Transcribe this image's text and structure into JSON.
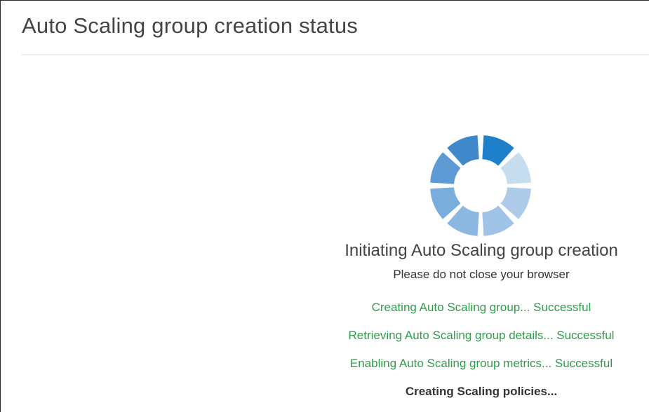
{
  "page": {
    "title": "Auto Scaling group creation status"
  },
  "status": {
    "heading": "Initiating Auto Scaling group creation",
    "subheading": "Please do not close your browser",
    "steps": [
      {
        "text": "Creating Auto Scaling group... Successful",
        "state": "success"
      },
      {
        "text": "Retrieving Auto Scaling group details... Successful",
        "state": "success"
      },
      {
        "text": "Enabling Auto Scaling group metrics... Successful",
        "state": "success"
      },
      {
        "text": "Creating Scaling policies...",
        "state": "in-progress"
      }
    ]
  },
  "colors": {
    "success": "#2e9e4a",
    "spinner_segments": [
      "#1e7fcb",
      "#c6dcef",
      "#aecce9",
      "#9ec3e6",
      "#8bb8e1",
      "#79addc",
      "#5e9bd4",
      "#3f88ca"
    ]
  },
  "icons": {
    "spinner": "loading-spinner-icon"
  }
}
